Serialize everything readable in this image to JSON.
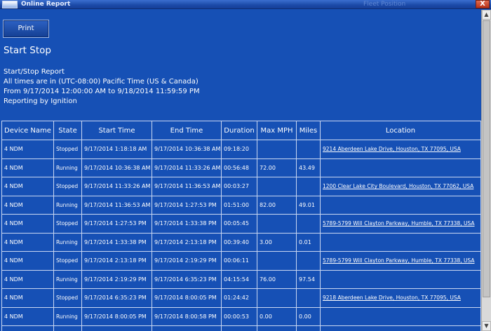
{
  "window": {
    "title": "Online Report",
    "ghost_text": "Fleet Position",
    "close_label": "X"
  },
  "toolbar": {
    "print_label": "Print"
  },
  "page_title": "Start Stop",
  "report_info": {
    "line1": "Start/Stop Report",
    "line2": "All times are in (UTC-08:00) Pacific Time (US & Canada)",
    "line3": "From 9/17/2014 12:00:00 AM to 9/18/2014 11:59:59 PM",
    "line4": "Reporting by Ignition"
  },
  "table": {
    "headers": [
      "Device Name",
      "State",
      "Start Time",
      "End Time",
      "Duration",
      "Max MPH",
      "Miles",
      "Location"
    ],
    "rows": [
      [
        "4 NDM",
        "Stopped",
        "9/17/2014 1:18:18 AM",
        "9/17/2014 10:36:38 AM",
        "09:18:20",
        "",
        "",
        "9214 Aberdeen Lake Drive, Houston, TX 77095, USA"
      ],
      [
        "4 NDM",
        "Running",
        "9/17/2014 10:36:38 AM",
        "9/17/2014 11:33:26 AM",
        "00:56:48",
        "72.00",
        "43.49",
        ""
      ],
      [
        "4 NDM",
        "Stopped",
        "9/17/2014 11:33:26 AM",
        "9/17/2014 11:36:53 AM",
        "00:03:27",
        "",
        "",
        "1200 Clear Lake City Boulevard, Houston, TX 77062, USA"
      ],
      [
        "4 NDM",
        "Running",
        "9/17/2014 11:36:53 AM",
        "9/17/2014 1:27:53 PM",
        "01:51:00",
        "82.00",
        "49.01",
        ""
      ],
      [
        "4 NDM",
        "Stopped",
        "9/17/2014 1:27:53 PM",
        "9/17/2014 1:33:38 PM",
        "00:05:45",
        "",
        "",
        "5789-5799 Will Clayton Parkway, Humble, TX 77338, USA"
      ],
      [
        "4 NDM",
        "Running",
        "9/17/2014 1:33:38 PM",
        "9/17/2014 2:13:18 PM",
        "00:39:40",
        "3.00",
        "0.01",
        ""
      ],
      [
        "4 NDM",
        "Stopped",
        "9/17/2014 2:13:18 PM",
        "9/17/2014 2:19:29 PM",
        "00:06:11",
        "",
        "",
        "5789-5799 Will Clayton Parkway, Humble, TX 77338, USA"
      ],
      [
        "4 NDM",
        "Running",
        "9/17/2014 2:19:29 PM",
        "9/17/2014 6:35:23 PM",
        "04:15:54",
        "76.00",
        "97.54",
        ""
      ],
      [
        "4 NDM",
        "Stopped",
        "9/17/2014 6:35:23 PM",
        "9/17/2014 8:00:05 PM",
        "01:24:42",
        "",
        "",
        "9218 Aberdeen Lake Drive, Houston, TX 77095, USA"
      ],
      [
        "4 NDM",
        "Running",
        "9/17/2014 8:00:05 PM",
        "9/17/2014 8:00:58 PM",
        "00:00:53",
        "0.00",
        "0.00",
        ""
      ],
      [
        "",
        "",
        "",
        "",
        "",
        "",
        "",
        ""
      ]
    ]
  },
  "colors": {
    "background": "#1650b5",
    "grid": "#c9d7f2",
    "close_button": "#c6401f"
  }
}
